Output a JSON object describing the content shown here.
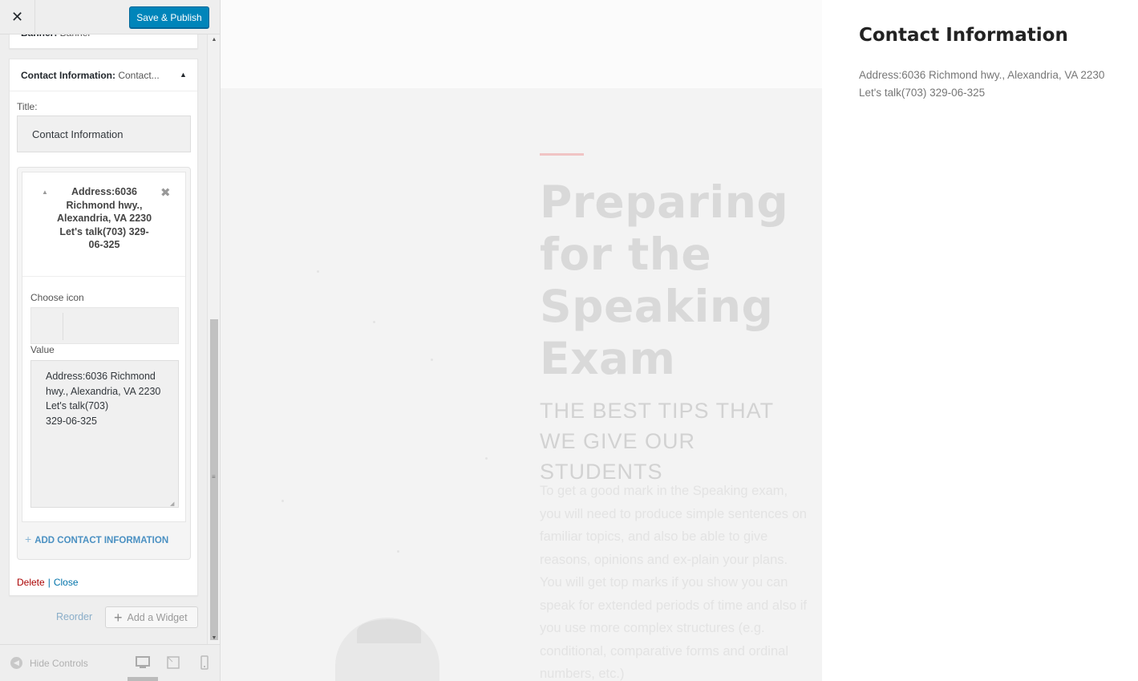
{
  "topbar": {
    "close_glyph": "✕",
    "publish_label": "Save & Publish"
  },
  "banner_widget": {
    "title": "Banner:",
    "subtitle": " Banner",
    "arrow_glyph": "▾"
  },
  "contact_widget": {
    "title": "Contact Information:",
    "subtitle": " Contact...",
    "arrow_glyph": "▲",
    "title_label": "Title:",
    "title_value": "Contact Information",
    "item": {
      "arrow_glyph": "▲",
      "remove_glyph": "✖",
      "heading": "Address:6036 Richmond hwy., Alexandria, VA 2230 Let's talk(703) 329-06-325",
      "icon_label": "Choose icon",
      "value_label": "Value",
      "value_text": "Address:6036 Richmond\nhwy., Alexandria, VA 2230\nLet's talk(703)\n329-06-325"
    },
    "add_label": "ADD CONTACT INFORMATION",
    "add_plus": "+",
    "delete_label": "Delete",
    "separator": "|",
    "close_label": "Close"
  },
  "widget_footer": {
    "reorder_label": "Reorder",
    "add_widget_label": "Add a Widget",
    "add_widget_plus": "+"
  },
  "footer": {
    "hide_controls_label": "Hide Controls",
    "hide_controls_icon": "◀",
    "devices": [
      "desktop-icon",
      "tablet-icon",
      "mobile-icon"
    ]
  },
  "preview": {
    "hero_title": "Preparing for the Speaking Exam",
    "hero_subtitle": "THE BEST TIPS THAT WE GIVE OUR STUDENTS",
    "hero_body": "To get a good mark in the Speaking exam, you will need to produce simple sentences on familiar topics, and also be able to give reasons, opinions and ex-plain your plans. You will get top marks if you show you can speak for extended periods of time and also if you use more complex structures (e.g. conditional, comparative forms and ordinal numbers, etc.)",
    "sidebar_title": "Contact Information",
    "sidebar_body": "Address:6036 Richmond hwy., Alexandria, VA 2230\nLet's talk(703) 329-06-325"
  },
  "colors": {
    "primary_button": "#0085ba",
    "link": "#0073aa",
    "delete": "#aa0000",
    "accent_rule": "#f0c4c4"
  }
}
